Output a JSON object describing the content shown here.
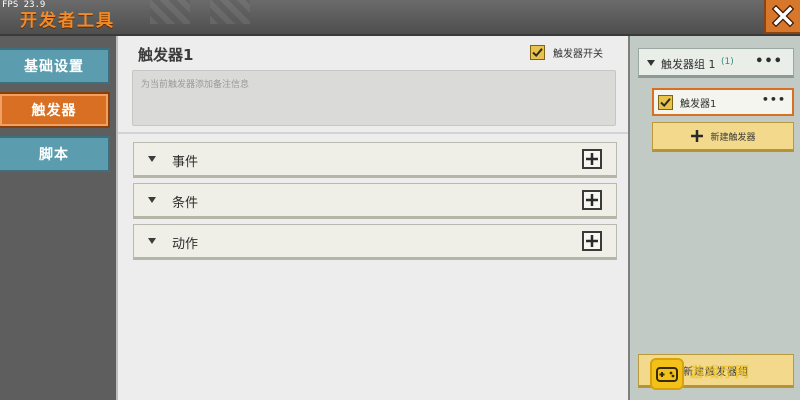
{
  "window": {
    "fps": "FPS 23.9",
    "title": "开发者工具",
    "close_icon": "close-icon",
    "accent_color": "#d96f22"
  },
  "sidebar": {
    "items": [
      {
        "label": "基础设置",
        "active": false
      },
      {
        "label": "触发器",
        "active": true
      },
      {
        "label": "脚本",
        "active": false
      }
    ]
  },
  "trigger": {
    "name": "触发器1",
    "toggle_label": "触发器开关",
    "toggle_checked": true,
    "note_placeholder": "为当前触发器添加备注信息",
    "sections": [
      {
        "label": "事件",
        "icon": "plus-icon"
      },
      {
        "label": "条件",
        "icon": "plus-icon"
      },
      {
        "label": "动作",
        "icon": "plus-icon"
      }
    ]
  },
  "right_panel": {
    "group_name": "触发器组 1",
    "group_count": "(1)",
    "more": "•••",
    "item_label": "触发器1",
    "item_checked": true,
    "new_trigger_label": "新建触发器",
    "new_group_label": "新建触发器组"
  },
  "watermark": {
    "text": "游戏厅网"
  }
}
